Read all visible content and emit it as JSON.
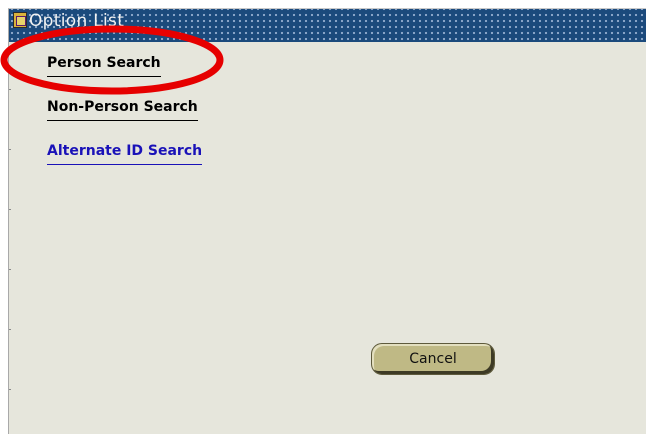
{
  "window": {
    "title": "Option List"
  },
  "options": [
    {
      "label": "Person Search"
    },
    {
      "label": "Non-Person Search"
    },
    {
      "label": "Alternate ID Search"
    }
  ],
  "buttons": {
    "cancel_label": "Cancel"
  },
  "colors": {
    "titlebar": "#1b4a7c",
    "panel": "#e6e6dc",
    "link_active": "#1a12b8",
    "highlight": "#e60000",
    "button": "#bfb985"
  }
}
